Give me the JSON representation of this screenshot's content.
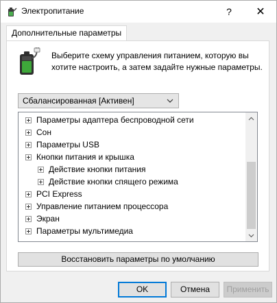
{
  "window": {
    "title": "Электропитание",
    "help_label": "?",
    "close_label": "✕"
  },
  "tab": {
    "label": "Дополнительные параметры"
  },
  "description": {
    "line1": "Выберите схему управления питанием, которую вы",
    "line2": "хотите настроить, а затем задайте нужные параметры."
  },
  "scheme_select": {
    "value": "Сбалансированная [Активен]"
  },
  "tree": {
    "items": [
      {
        "label": "Параметры адаптера беспроводной сети",
        "level": 0
      },
      {
        "label": "Сон",
        "level": 0
      },
      {
        "label": "Параметры USB",
        "level": 0
      },
      {
        "label": "Кнопки питания и крышка",
        "level": 0
      },
      {
        "label": "Действие кнопки питания",
        "level": 1
      },
      {
        "label": "Действие кнопки спящего режима",
        "level": 1
      },
      {
        "label": "PCI Express",
        "level": 0
      },
      {
        "label": "Управление питанием процессора",
        "level": 0
      },
      {
        "label": "Экран",
        "level": 0
      },
      {
        "label": "Параметры мультимедиа",
        "level": 0
      }
    ]
  },
  "buttons": {
    "restore": "Восстановить параметры по умолчанию",
    "ok": "OK",
    "cancel": "Отмена",
    "apply": "Применить"
  },
  "colors": {
    "accent": "#0078d7",
    "battery_green": "#3ea83a"
  },
  "icons": {
    "title": "power-options-icon",
    "scheme": "battery-plug-icon"
  }
}
